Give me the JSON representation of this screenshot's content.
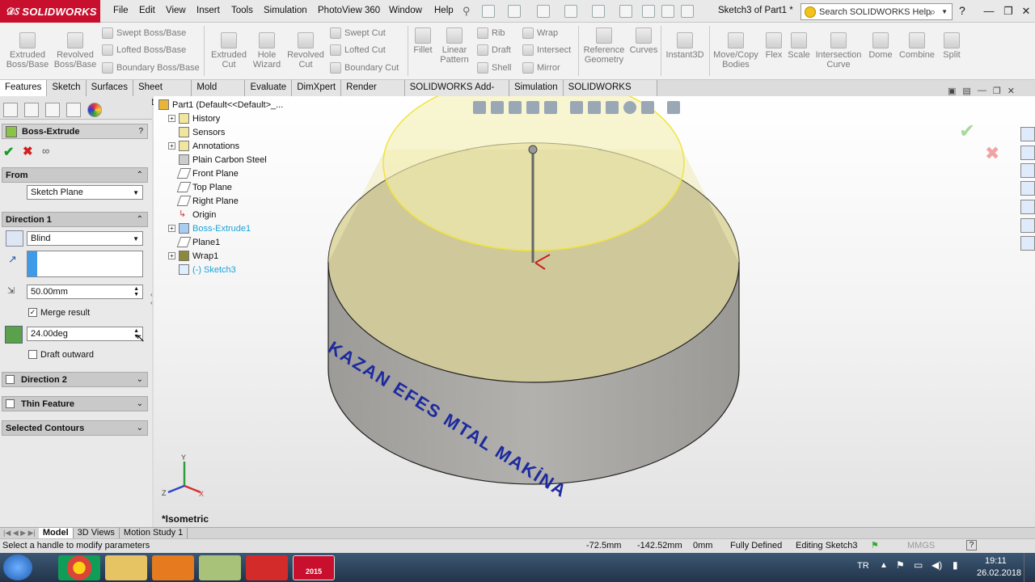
{
  "app": {
    "logo": "SOLIDWORKS",
    "document_title": "Sketch3 of Part1 *"
  },
  "menu": [
    "File",
    "Edit",
    "View",
    "Insert",
    "Tools",
    "Simulation",
    "PhotoView 360",
    "Window",
    "Help"
  ],
  "search": {
    "placeholder": "Search SOLIDWORKS Help"
  },
  "ribbon": {
    "large": [
      {
        "label": "Extruded\nBoss/Base",
        "icon": "extruded-boss-icon"
      },
      {
        "label": "Revolved\nBoss/Base",
        "icon": "revolved-boss-icon"
      },
      {
        "label": "Extruded\nCut",
        "icon": "extruded-cut-icon"
      },
      {
        "label": "Hole\nWizard",
        "icon": "hole-wizard-icon"
      },
      {
        "label": "Revolved\nCut",
        "icon": "revolved-cut-icon"
      },
      {
        "label": "Fillet",
        "icon": "fillet-icon"
      },
      {
        "label": "Linear\nPattern",
        "icon": "linear-pattern-icon"
      },
      {
        "label": "Reference\nGeometry",
        "icon": "reference-geometry-icon"
      },
      {
        "label": "Curves",
        "icon": "curves-icon"
      },
      {
        "label": "Instant3D",
        "icon": "instant3d-icon"
      },
      {
        "label": "Move/Copy\nBodies",
        "icon": "move-copy-icon"
      },
      {
        "label": "Flex",
        "icon": "flex-icon"
      },
      {
        "label": "Scale",
        "icon": "scale-icon"
      },
      {
        "label": "Intersection\nCurve",
        "icon": "intersection-curve-icon"
      },
      {
        "label": "Dome",
        "icon": "dome-icon"
      },
      {
        "label": "Combine",
        "icon": "combine-icon"
      },
      {
        "label": "Split",
        "icon": "split-icon"
      }
    ],
    "small": [
      "Swept Boss/Base",
      "Lofted Boss/Base",
      "Boundary Boss/Base",
      "Swept Cut",
      "Lofted Cut",
      "Boundary Cut",
      "Rib",
      "Draft",
      "Shell",
      "Wrap",
      "Intersect",
      "Mirror"
    ]
  },
  "tabs": [
    "Features",
    "Sketch",
    "Surfaces",
    "Sheet Metal",
    "Mold Tools",
    "Evaluate",
    "DimXpert",
    "Render Tools",
    "SOLIDWORKS Add-Ins",
    "Simulation",
    "SOLIDWORKS MBD"
  ],
  "property_manager": {
    "title": "Boss-Extrude",
    "help": "?",
    "from_header": "From",
    "from_value": "Sketch Plane",
    "dir1_header": "Direction 1",
    "end_condition": "Blind",
    "depth": "50.00mm",
    "merge_label": "Merge result",
    "draft_angle": "24.00deg",
    "draft_outward_label": "Draft outward",
    "dir2_header": "Direction 2",
    "thin_header": "Thin Feature",
    "contours_header": "Selected Contours"
  },
  "tree": {
    "root": "Part1  (Default<<Default>_...",
    "items": [
      "History",
      "Sensors",
      "Annotations",
      "Plain Carbon Steel",
      "Front Plane",
      "Top Plane",
      "Right Plane",
      "Origin",
      "Boss-Extrude1",
      "Plane1",
      "Wrap1",
      "(-) Sketch3"
    ]
  },
  "viewport": {
    "model_text": "KAZAN EFES MTAL MAKİNA",
    "view_label": "*Isometric",
    "triad": {
      "x": "X",
      "y": "Y",
      "z": "Z"
    }
  },
  "bottom_tabs": [
    "Model",
    "3D Views",
    "Motion Study 1"
  ],
  "status": {
    "hint": "Select a handle to modify parameters",
    "x": "-72.5mm",
    "y": "-142.52mm",
    "z": "0mm",
    "state": "Fully Defined",
    "editing": "Editing Sketch3",
    "units": "MMGS",
    "help": "?"
  },
  "taskbar": {
    "lang": "TR",
    "time": "19:11",
    "date": "26.02.2018",
    "sw_badge": "2015"
  },
  "colors": {
    "accent": "#c8102e",
    "model_face": "#cfc89a",
    "model_side": "#a9a8a4",
    "preview_face": "#f3eeb0",
    "text_blue": "#1d2a9e",
    "tree_highlight": "#1ca3d8"
  }
}
